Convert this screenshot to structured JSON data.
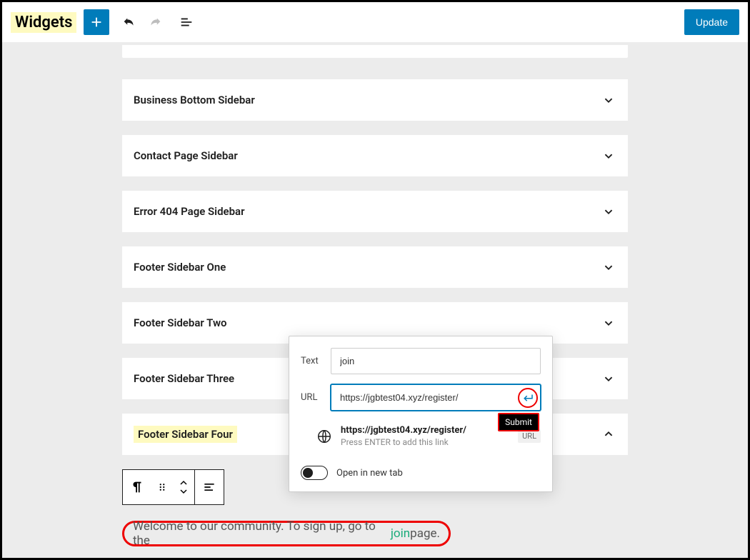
{
  "header": {
    "title": "Widgets",
    "update_label": "Update"
  },
  "areas": [
    {
      "label": "Business Bottom Sidebar",
      "expanded": false
    },
    {
      "label": "Contact Page Sidebar",
      "expanded": false
    },
    {
      "label": "Error 404 Page Sidebar",
      "expanded": false
    },
    {
      "label": "Footer Sidebar One",
      "expanded": false
    },
    {
      "label": "Footer Sidebar Two",
      "expanded": false
    },
    {
      "label": "Footer Sidebar Three",
      "expanded": false
    },
    {
      "label": "Footer Sidebar Four",
      "expanded": true
    }
  ],
  "link_popover": {
    "text_label": "Text",
    "text_value": "join",
    "url_label": "URL",
    "url_value": "https://jgbtest04.xyz/register/",
    "submit_tooltip": "Submit",
    "suggestion_title": "https://jgbtest04.xyz/register/",
    "suggestion_hint": "Press ENTER to add this link",
    "suggestion_badge": "URL",
    "toggle_label": "Open in new tab",
    "toggle_on": false
  },
  "paragraph": {
    "before_link": "Welcome to our community. To sign up, go to the ",
    "link_text": "join",
    "after_link": " page."
  }
}
